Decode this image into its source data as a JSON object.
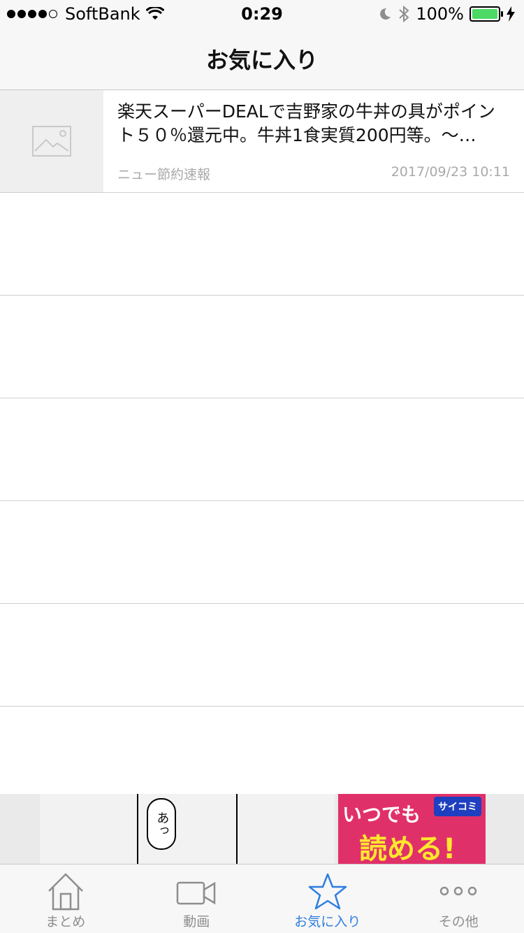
{
  "status_bar": {
    "carrier": "SoftBank",
    "time": "0:29",
    "battery": "100%",
    "battery_level": 1.0
  },
  "nav": {
    "title": "お気に入り"
  },
  "list": {
    "items": [
      {
        "title": "楽天スーパーDEALで吉野家の牛丼の具がポイント５０％還元中。牛丼1食実質200円等。〜…",
        "source": "ニュー節約速報",
        "date": "2017/09/23 10:11",
        "thumb_icon": "image-placeholder-icon"
      }
    ]
  },
  "ad": {
    "bubble_text": "あっ",
    "tagline": "いつでも",
    "headline": "読める!",
    "logo": "サイコミ"
  },
  "tab_bar": {
    "tabs": [
      {
        "label": "まとめ",
        "icon": "home-icon"
      },
      {
        "label": "動画",
        "icon": "video-icon"
      },
      {
        "label": "お気に入り",
        "icon": "star-icon",
        "active": true
      },
      {
        "label": "その他",
        "icon": "more-icon"
      }
    ]
  },
  "colors": {
    "accent": "#2f7ee0",
    "inactive": "#8e8e8e",
    "battery": "#4cd964"
  }
}
